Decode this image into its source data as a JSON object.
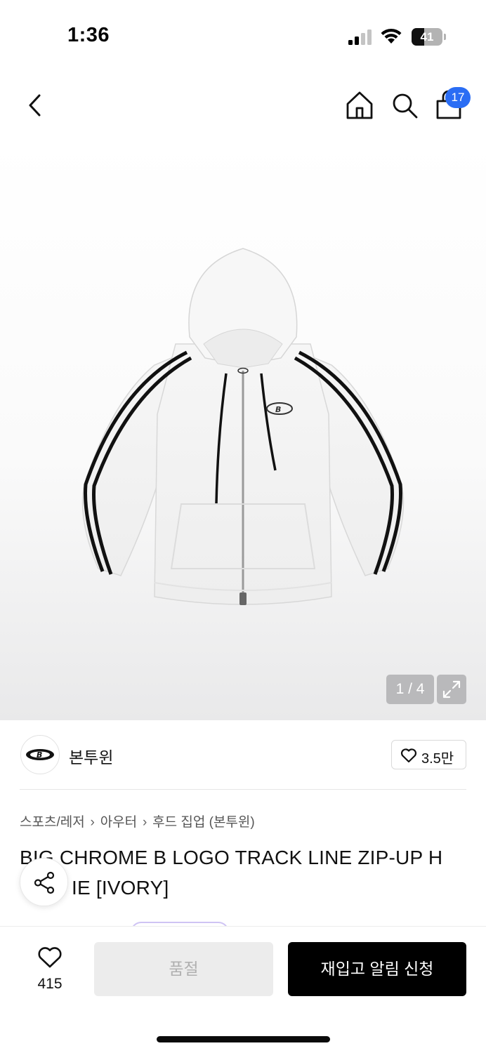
{
  "status_bar": {
    "time": "1:36",
    "battery_level": "41",
    "battery_fraction": 0.41,
    "signal_icon": "cellular-signal-icon",
    "wifi_icon": "wifi-icon"
  },
  "nav": {
    "back_icon": "chevron-left-icon",
    "home_icon": "home-icon",
    "search_icon": "search-icon",
    "cart_icon": "shopping-bag-icon",
    "cart_count": "17",
    "badge_color": "#2a6df4"
  },
  "gallery": {
    "page_indicator": "1 / 4",
    "current_page": 1,
    "total_pages": 4,
    "expand_icon": "expand-icon"
  },
  "brand": {
    "name": "본투윈",
    "like_count": "3.5만",
    "heart_icon": "heart-outline-icon"
  },
  "breadcrumb": {
    "items": [
      "스포츠/레저",
      "아우터",
      "후드 집업 (본투윈)"
    ],
    "separator_icon": "chevron-right-icon"
  },
  "product": {
    "title": "BIG CHROME B LOGO TRACK LINE ZIP-UP HOODIE [IVORY]",
    "title_line1": "BIG CHROME B LOGO TRACK LINE ZIP-UP H",
    "title_line2": "IE [IVORY]"
  },
  "share": {
    "icon": "share-icon"
  },
  "bottom_bar": {
    "wish_count": "415",
    "soldout_label": "품절",
    "restock_label": "재입고 알림 신청",
    "primary_color": "#000000"
  }
}
